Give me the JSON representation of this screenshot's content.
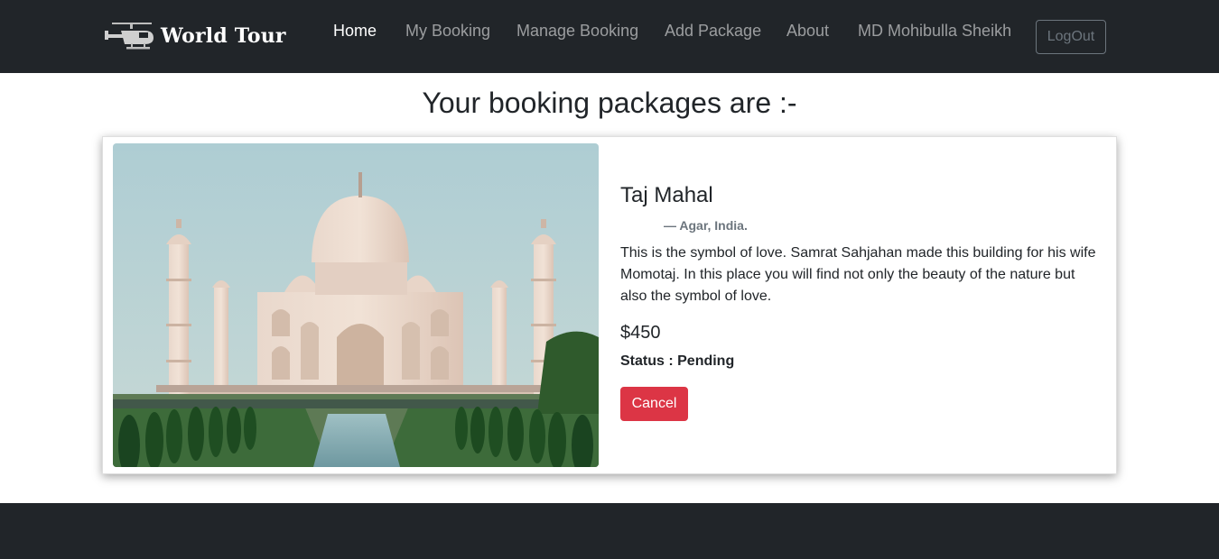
{
  "nav": {
    "brand": "World Tour",
    "brand_icon": "helicopter-icon",
    "links": [
      "Home",
      "My Booking",
      "Manage Booking",
      "Add Package",
      "About"
    ],
    "active_link": "Home",
    "user_name": "MD Mohibulla Sheikh",
    "logout_label": "LogOut"
  },
  "page": {
    "title": "Your booking packages are :-"
  },
  "bookings": [
    {
      "name": "Taj Mahal",
      "location": "— Agar, India.",
      "description": "This is the symbol of love. Samrat Sahjahan made this building for his wife Momotaj. In this place you will find not only the beauty of the nature but also the symbol of love.",
      "price": "$450",
      "status": "Status : Pending",
      "cancel_label": "Cancel"
    }
  ],
  "colors": {
    "navbar_bg": "#212529",
    "danger": "#dc3545",
    "muted": "#6c757d"
  }
}
